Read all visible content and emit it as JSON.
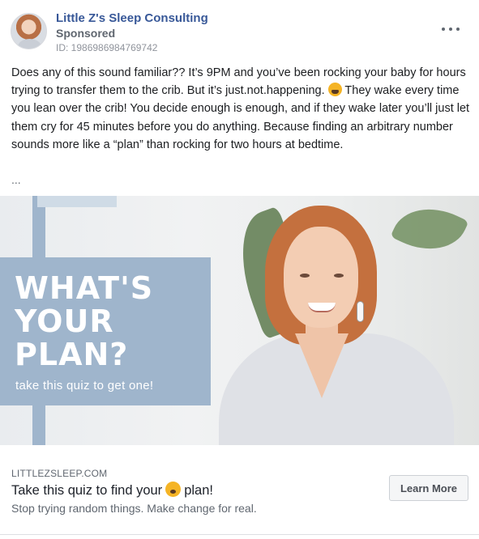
{
  "header": {
    "page_name": "Little Z's Sleep Consulting",
    "sponsored": "Sponsored",
    "ad_id": "ID: 1986986984769742"
  },
  "post": {
    "text_part1": "Does any of this sound familiar?? It’s 9PM and you’ve been rocking your baby for hours trying to transfer them to the crib. But it’s just.not.happening.",
    "emoji_1": "tired-face-emoji",
    "text_part2": "They wake every time you lean over the crib! You decide enough is enough, and if they wake later you’ll just let them cry for 45 minutes before you do anything. Because finding an arbitrary number sounds more like a “plan” than rocking for two hours at bedtime.",
    "see_more": "..."
  },
  "hero": {
    "headline": "WHAT'S\nYOUR\nPLAN?",
    "subtitle": "take this quiz to get one!",
    "panel_color": "#9fb5cc"
  },
  "link": {
    "domain": "LITTLEZSLEEP.COM",
    "title_part1": "Take this quiz to find your",
    "emoji_2": "sleeping-face-emoji",
    "title_part2": "plan!",
    "description": "Stop trying random things. Make change for real.",
    "cta_label": "Learn More"
  },
  "colors": {
    "link_blue": "#385898",
    "secondary_text": "#606770",
    "button_bg": "#f5f6f7"
  }
}
